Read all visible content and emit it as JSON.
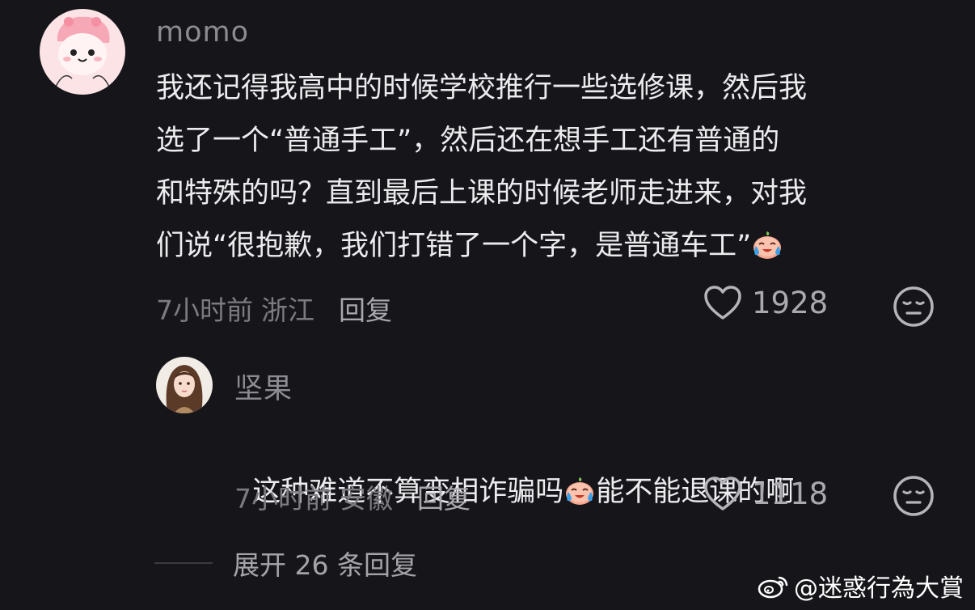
{
  "comment": {
    "username": "momo",
    "lines": [
      "我还记得我高中的时候学校推行一些选修课，然后我",
      "选了一个“普通手工”，然后还在想手工还有普通的",
      "和特殊的吗？直到最后上课的时候老师走进来，对我",
      "们说“很抱歉，我们打错了一个字，是普通车工”"
    ],
    "emoji": "crying-laughing-emoji",
    "time": "7小时前",
    "location": "浙江",
    "reply_label": "回复",
    "likes": "1928"
  },
  "reply": {
    "username": "坚果",
    "text_before": "这种难道不算变相诈骗吗",
    "emoji": "crying-laughing-emoji",
    "text_after": "能不能退课的啊",
    "time": "7小时前",
    "location": "安徽",
    "reply_label": "回复",
    "likes": "1118"
  },
  "expand_label": "展开 26 条回复",
  "watermark": "@迷惑行為大賞",
  "colors": {
    "background": "#16161a",
    "text": "#ececef",
    "muted": "#7b7b81"
  }
}
